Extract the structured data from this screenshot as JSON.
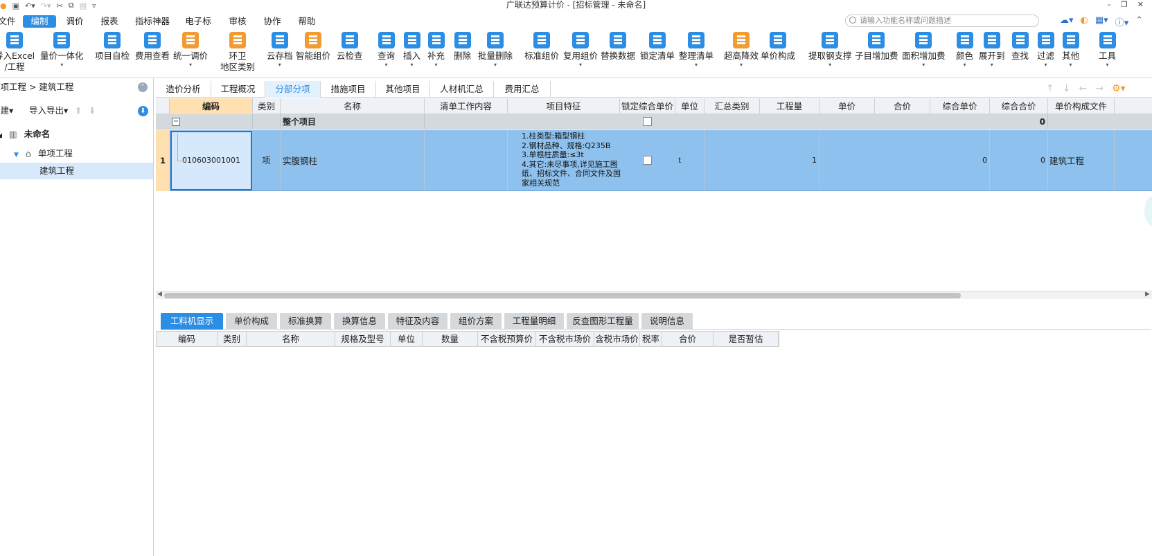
{
  "titlebar": {
    "title": "广联达预算计价 - [招标管理 - 未命名]"
  },
  "menu": [
    "文件",
    "编制",
    "调价",
    "报表",
    "指标神器",
    "电子标",
    "审核",
    "协作",
    "帮助"
  ],
  "search": {
    "placeholder": "请输入功能名称或问题描述"
  },
  "ribbon": [
    {
      "label": "导入Excel",
      "label2": "/工程"
    },
    {
      "label": "量价一体化",
      "label2": "▾"
    },
    {
      "label": "项目自检"
    },
    {
      "label": "费用查看"
    },
    {
      "label": "统一调价",
      "label2": "▾"
    },
    {
      "label": "环卫",
      "label2": "地区类别"
    },
    {
      "label": "云存档",
      "label2": "▾"
    },
    {
      "label": "智能组价"
    },
    {
      "label": "云检查"
    },
    {
      "label": "查询",
      "label2": "▾"
    },
    {
      "label": "插入",
      "label2": "▾"
    },
    {
      "label": "补充",
      "label2": "▾"
    },
    {
      "label": "删除"
    },
    {
      "label": "批量删除",
      "label2": "▾"
    },
    {
      "label": "标准组价"
    },
    {
      "label": "复用组价",
      "label2": "▾"
    },
    {
      "label": "替换数据"
    },
    {
      "label": "锁定清单"
    },
    {
      "label": "整理清单",
      "label2": "▾"
    },
    {
      "label": "超高降效",
      "label2": "▾"
    },
    {
      "label": "单价构成"
    },
    {
      "label": "提取钢支撑",
      "label2": "▾"
    },
    {
      "label": "子目增加费"
    },
    {
      "label": "面积增加费",
      "label2": "▾"
    },
    {
      "label": "颜色",
      "label2": "▾"
    },
    {
      "label": "展开到",
      "label2": "▾"
    },
    {
      "label": "查找"
    },
    {
      "label": "过滤",
      "label2": "▾"
    },
    {
      "label": "其他",
      "label2": "▾"
    },
    {
      "label": "工具",
      "label2": "▾"
    }
  ],
  "left": {
    "breadcrumb": "单项工程 > 建筑工程",
    "new_label": "新建▾",
    "import_export": "导入导出▾",
    "tree": [
      "未命名",
      "单项工程",
      "建筑工程"
    ]
  },
  "main_tabs": [
    "造价分析",
    "工程概况",
    "分部分项",
    "措施项目",
    "其他项目",
    "人材机汇总",
    "费用汇总"
  ],
  "grid": {
    "headers": [
      "编码",
      "类别",
      "名称",
      "清单工作内容",
      "项目特征",
      "锁定综合单价",
      "单位",
      "汇总类别",
      "工程量",
      "单价",
      "合价",
      "综合单价",
      "综合合价",
      "单价构成文件"
    ],
    "total_row": {
      "toggle": "−",
      "name": "整个项目",
      "total": "0"
    },
    "row": {
      "num": "1",
      "code": "010603001001",
      "type": "项",
      "name": "实腹钢柱",
      "features": [
        "1.柱类型:箱型钢柱",
        "2.钢材品种、规格:Q235B",
        "3.单根柱质量:≤3t",
        "4.其它:未尽事项,详见施工图",
        "纸、招标文件、合同文件及国",
        "家相关规范"
      ],
      "unit": "t",
      "quantity": "1",
      "unit_comp": "0",
      "total_comp": "0",
      "file": "建筑工程"
    }
  },
  "bottom_tabs": [
    "工料机显示",
    "单价构成",
    "标准换算",
    "换算信息",
    "特征及内容",
    "组价方案",
    "工程量明细",
    "反查图形工程量",
    "说明信息"
  ],
  "bottom_headers": [
    "编码",
    "类别",
    "名称",
    "规格及型号",
    "单位",
    "数量",
    "不含税预算价",
    "不含税市场价",
    "含税市场价",
    "税率",
    "合价",
    "是否暂估"
  ]
}
